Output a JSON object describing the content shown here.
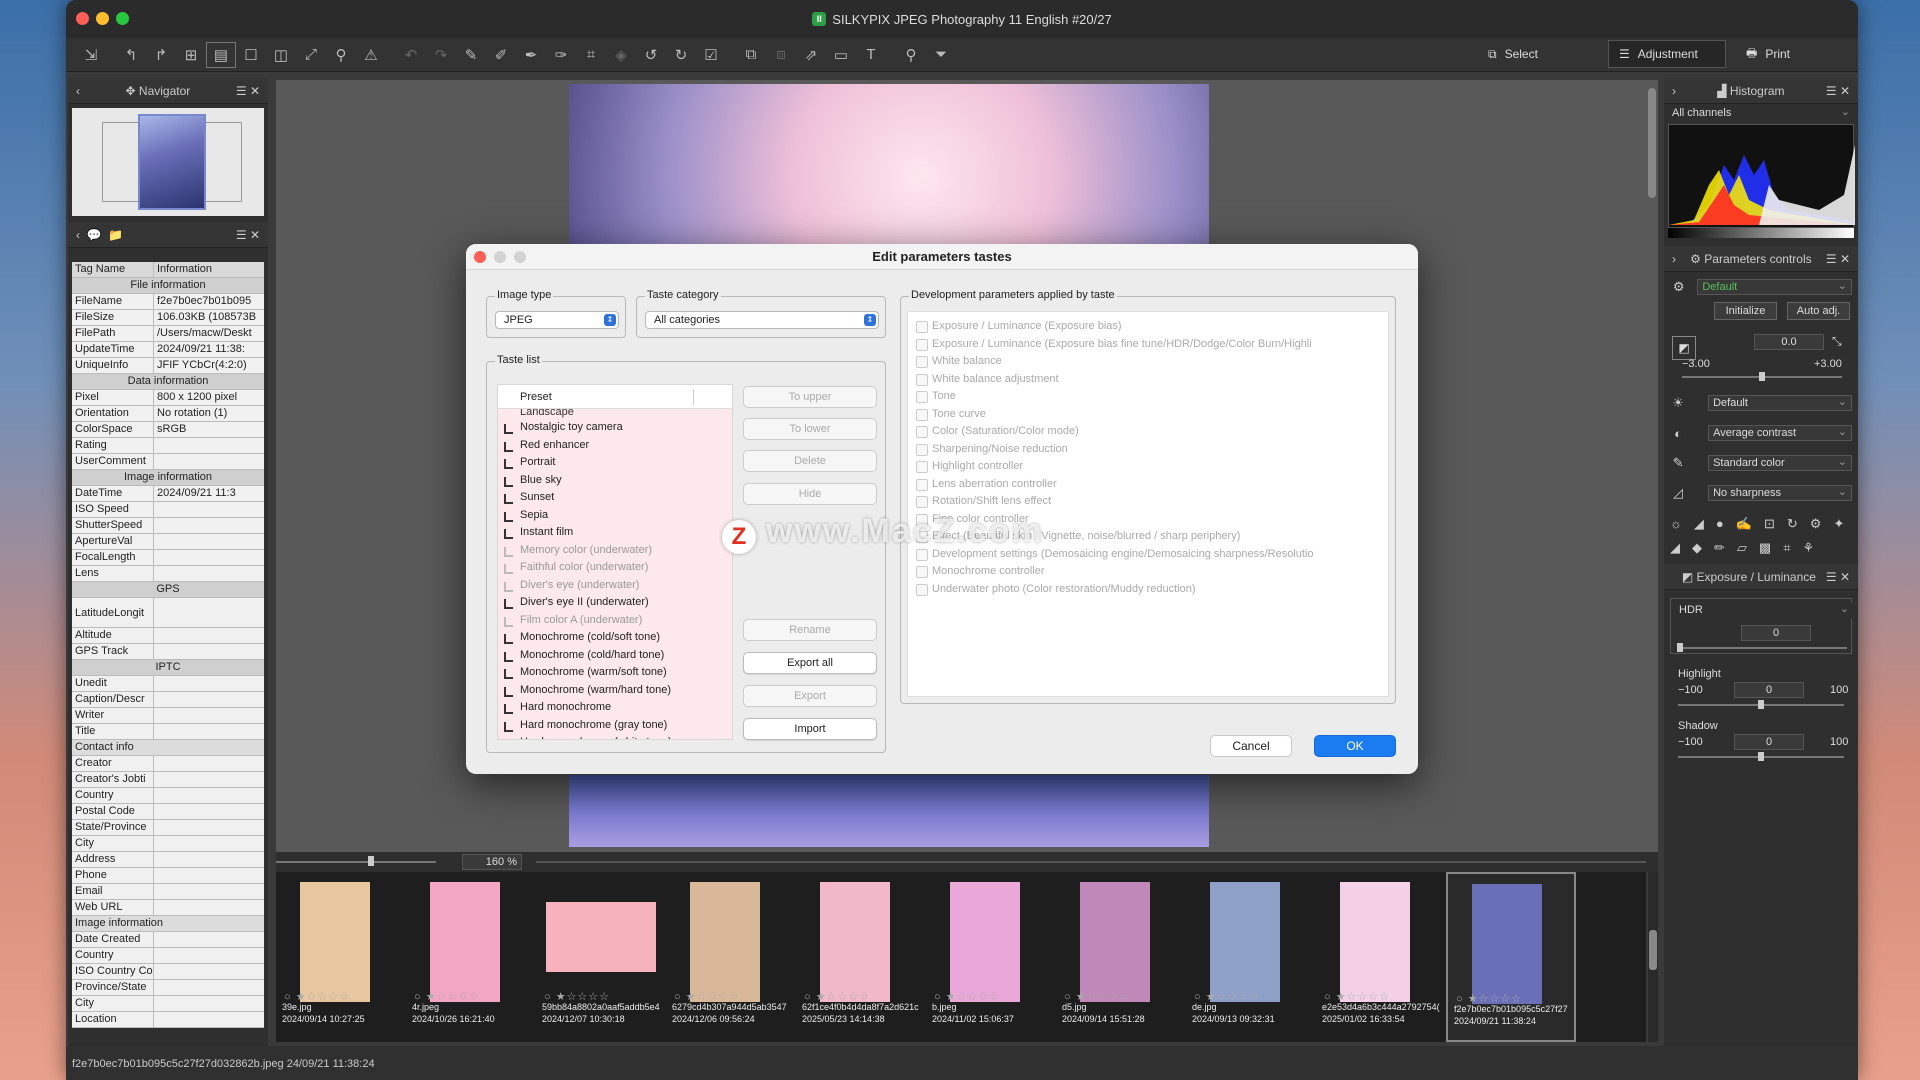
{
  "window": {
    "title": "SILKYPIX JPEG Photography 11 English  #20/27"
  },
  "modes": {
    "select": "Select",
    "adjustment": "Adjustment",
    "print": "Print"
  },
  "navigator": {
    "title": "Navigator"
  },
  "info": {
    "col_tag": "Tag Name",
    "col_info": "Information",
    "sections": {
      "file": "File information",
      "data": "Data information",
      "image": "Image information",
      "gps": "GPS",
      "iptc": "IPTC",
      "contact": "Contact info",
      "image2": "Image information"
    },
    "rows": {
      "filename": [
        "FileName",
        "f2e7b0ec7b01b095"
      ],
      "filesize": [
        "FileSize",
        "106.03KB (108573B"
      ],
      "filepath": [
        "FilePath",
        "/Users/macw/Deskt"
      ],
      "updatetime": [
        "UpdateTime",
        "2024/09/21 11:38:"
      ],
      "uniqueinfo": [
        "UniqueInfo",
        "JFIF YCbCr(4:2:0)"
      ],
      "pixel": [
        "Pixel",
        "800 x 1200 pixel"
      ],
      "orientation": [
        "Orientation",
        "No rotation (1)"
      ],
      "colorspace": [
        "ColorSpace",
        "sRGB"
      ],
      "rating": [
        "Rating",
        ""
      ],
      "usercomment": [
        "UserComment",
        ""
      ],
      "datetime": [
        "DateTime",
        "2024/09/21 11:3"
      ],
      "iso": [
        "ISO Speed",
        ""
      ],
      "shutter": [
        "ShutterSpeed",
        ""
      ],
      "aperture": [
        "ApertureVal",
        ""
      ],
      "focal": [
        "FocalLength",
        ""
      ],
      "lens": [
        "Lens",
        ""
      ],
      "latlong": [
        "LatitudeLongit",
        ""
      ],
      "altitude": [
        "Altitude",
        ""
      ],
      "gpstrack": [
        "GPS Track",
        ""
      ],
      "unedit": [
        "Unedit",
        ""
      ],
      "caption": [
        "Caption/Descr",
        ""
      ],
      "writer": [
        "Writer",
        ""
      ],
      "title": [
        "Title",
        ""
      ],
      "creator": [
        "Creator",
        ""
      ],
      "creatorjob": [
        "Creator's Jobti",
        ""
      ],
      "country": [
        "Country",
        ""
      ],
      "postal": [
        "Postal Code",
        ""
      ],
      "state": [
        "State/Province",
        ""
      ],
      "city": [
        "City",
        ""
      ],
      "address": [
        "Address",
        ""
      ],
      "phone": [
        "Phone",
        ""
      ],
      "email": [
        "Email",
        ""
      ],
      "weburl": [
        "Web URL",
        ""
      ],
      "datecreated": [
        "Date Created",
        ""
      ],
      "country2": [
        "Country",
        ""
      ],
      "isocountry": [
        "ISO Country Co",
        ""
      ],
      "provstate": [
        "Province/State",
        ""
      ],
      "city2": [
        "City",
        ""
      ],
      "location": [
        "Location",
        ""
      ]
    }
  },
  "viewer": {
    "zoom": "160 %"
  },
  "filmstrip": [
    {
      "name": "39e.jpg",
      "date": "2024/09/14 10:27:25",
      "color": "#e8c7a0"
    },
    {
      "name": "4r.jpeg",
      "date": "2024/10/26 16:21:40",
      "color": "#f2a6c2"
    },
    {
      "name": "59bb84a8802a0aaf5addb5e4",
      "date": "2024/12/07 10:30:18",
      "color": "#f6b2bd"
    },
    {
      "name": "6279cd4b307a944d5ab3547",
      "date": "2024/12/06 09:56:24",
      "color": "#d9b89a"
    },
    {
      "name": "62f1ce4f0b4d4da8f7a2d621c",
      "date": "2025/05/23 14:14:38",
      "color": "#f0b8c8"
    },
    {
      "name": "b.jpeg",
      "date": "2024/11/02 15:06:37",
      "color": "#e9a8d8"
    },
    {
      "name": "d5.jpg",
      "date": "2024/09/14 15:51:28",
      "color": "#c088b8"
    },
    {
      "name": "de.jpg",
      "date": "2024/09/13 09:32:31",
      "color": "#8fa0c8"
    },
    {
      "name": "e2e53d4a6b3c444a2792754(",
      "date": "2025/01/02 16:33:54",
      "color": "#f3d0e6"
    },
    {
      "name": "f2e7b0ec7b01b095c5c27f27",
      "date": "2024/09/21 11:38:24",
      "color": "#6a70b8"
    }
  ],
  "status": {
    "text": "f2e7b0ec7b01b095c5c27f27d032862b.jpeg 24/09/21 11:38:24"
  },
  "right": {
    "histogram": "Histogram",
    "channels": "All channels",
    "params": "Parameters controls",
    "preset": "Default",
    "initialize": "Initialize",
    "auto": "Auto adj.",
    "ev": "0.0",
    "ev_min": "−3.00",
    "ev_max": "+3.00",
    "wb": "Default",
    "contrast": "Average contrast",
    "color": "Standard color",
    "sharp": "No sharpness",
    "exposure_panel": "Exposure / Luminance",
    "hdr": "HDR",
    "hdr_val": "0",
    "highlight": "Highlight",
    "hl_min": "−100",
    "hl_val": "0",
    "hl_max": "100",
    "shadow": "Shadow",
    "sh_min": "−100",
    "sh_val": "0",
    "sh_max": "100"
  },
  "dialog": {
    "title": "Edit parameters tastes",
    "image_type_label": "Image type",
    "image_type": "JPEG",
    "taste_category_label": "Taste category",
    "taste_category": "All categories",
    "taste_list_label": "Taste list",
    "preset_header": "Preset",
    "cut_item": "Landscape",
    "tastes": [
      {
        "label": "Nostalgic toy camera",
        "dim": false
      },
      {
        "label": "Red enhancer",
        "dim": false
      },
      {
        "label": "Portrait",
        "dim": false
      },
      {
        "label": "Blue sky",
        "dim": false
      },
      {
        "label": "Sunset",
        "dim": false
      },
      {
        "label": "Sepia",
        "dim": false
      },
      {
        "label": "Instant film",
        "dim": false
      },
      {
        "label": "Memory color (underwater)",
        "dim": true
      },
      {
        "label": "Faithful color (underwater)",
        "dim": true
      },
      {
        "label": "Diver's eye (underwater)",
        "dim": true
      },
      {
        "label": "Diver's eye II (underwater)",
        "dim": false
      },
      {
        "label": "Film color A (underwater)",
        "dim": true
      },
      {
        "label": "Monochrome (cold/soft tone)",
        "dim": false
      },
      {
        "label": "Monochrome (cold/hard tone)",
        "dim": false
      },
      {
        "label": "Monochrome (warm/soft tone)",
        "dim": false
      },
      {
        "label": "Monochrome (warm/hard tone)",
        "dim": false
      },
      {
        "label": "Hard monochrome",
        "dim": false
      },
      {
        "label": "Hard monochrome (gray tone)",
        "dim": false
      },
      {
        "label": "Hard monochrome (white tone)",
        "dim": false
      }
    ],
    "btn_upper": "To upper",
    "btn_lower": "To lower",
    "btn_delete": "Delete",
    "btn_hide": "Hide",
    "btn_rename": "Rename",
    "btn_export_all": "Export all",
    "btn_export": "Export",
    "btn_import": "Import",
    "dev_label": "Development parameters applied by taste",
    "dev_items": [
      "Exposure / Luminance (Exposure bias)",
      "Exposure / Luminance (Exposure bias fine tune/HDR/Dodge/Color Burn/Highli",
      "White balance",
      "White balance adjustment",
      "Tone",
      "Tone curve",
      "Color (Saturation/Color mode)",
      "Sharpening/Noise reduction",
      "Highlight controller",
      "Lens aberration controller",
      "Rotation/Shift lens effect",
      "Fine color controller",
      "Effect (Beautiful skin / Vignette, noise/blurred / sharp periphery)",
      "Development settings (Demosaicing engine/Demosaicing sharpness/Resolutio",
      "Monochrome controller",
      "Underwater photo (Color restoration/Muddy reduction)"
    ],
    "cancel": "Cancel",
    "ok": "OK",
    "watermark": "www.MacZ.com",
    "wm_letter": "Z"
  }
}
